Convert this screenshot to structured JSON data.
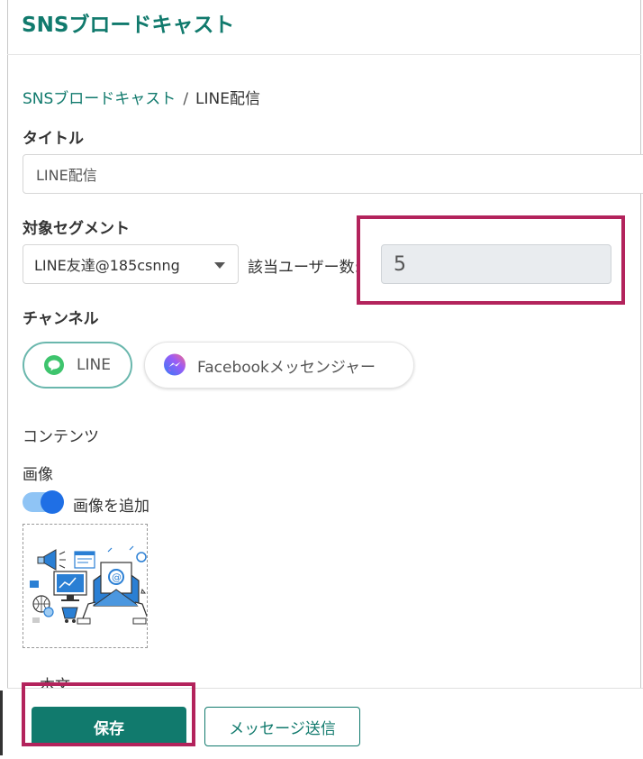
{
  "page_title": "SNSブロードキャスト",
  "breadcrumb": {
    "parent": "SNSブロードキャスト",
    "separator": "/",
    "current": "LINE配信"
  },
  "title_section": {
    "label": "タイトル",
    "value": "LINE配信"
  },
  "segment_section": {
    "label": "対象セグメント",
    "selected": "LINE友達@185csnng",
    "user_count_label": "該当ユーザー数:",
    "user_count": "5"
  },
  "channel_section": {
    "label": "チャンネル",
    "options": [
      {
        "label": "LINE",
        "selected": true,
        "icon": "line-icon"
      },
      {
        "label": "Facebookメッセンジャー",
        "selected": false,
        "icon": "messenger-icon"
      }
    ]
  },
  "content_section": {
    "label": "コンテンツ",
    "image_label": "画像",
    "add_image_toggle": {
      "label": "画像を追加",
      "on": true
    },
    "body_label": "本文"
  },
  "footer": {
    "save_label": "保存",
    "send_label": "メッセージ送信"
  },
  "colors": {
    "brand": "#117a6d",
    "highlight": "#b3235c",
    "toggle": "#1f6fe5"
  }
}
